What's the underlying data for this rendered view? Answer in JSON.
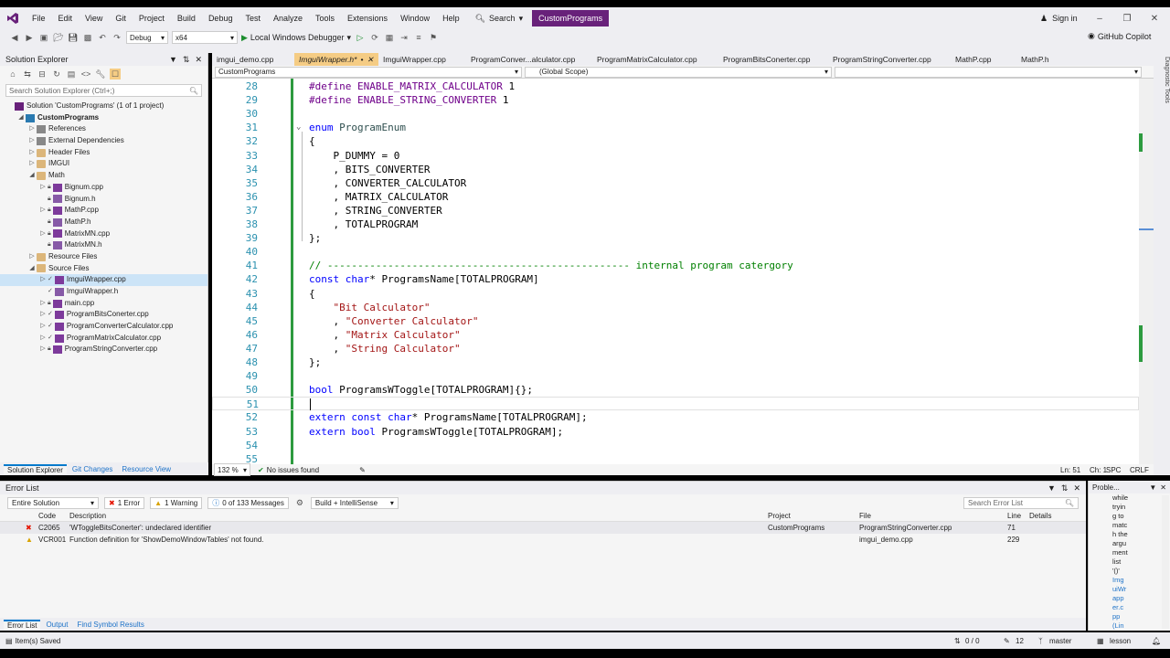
{
  "menu": [
    "File",
    "Edit",
    "View",
    "Git",
    "Project",
    "Build",
    "Debug",
    "Test",
    "Analyze",
    "Tools",
    "Extensions",
    "Window",
    "Help"
  ],
  "search_label": "Search",
  "solution_name": "CustomPrograms",
  "signin_label": "Sign in",
  "toolbar": {
    "config": "Debug",
    "platform": "x64",
    "run_label": "Local Windows Debugger",
    "copilot_label": "GitHub Copilot"
  },
  "solution_explorer": {
    "title": "Solution Explorer",
    "search_placeholder": "Search Solution Explorer (Ctrl+;)",
    "items": [
      {
        "label": "Solution 'CustomPrograms' (1 of 1 project)",
        "indent": 0,
        "icon": "solution"
      },
      {
        "label": "CustomPrograms",
        "indent": 1,
        "icon": "project",
        "bold": true
      },
      {
        "label": "References",
        "indent": 2,
        "icon": "ref"
      },
      {
        "label": "External Dependencies",
        "indent": 2,
        "icon": "ref"
      },
      {
        "label": "Header Files",
        "indent": 2,
        "icon": "folder"
      },
      {
        "label": "IMGUI",
        "indent": 2,
        "icon": "folder"
      },
      {
        "label": "Math",
        "indent": 2,
        "icon": "folder"
      },
      {
        "label": "Bignum.cpp",
        "indent": 3,
        "icon": "cpp"
      },
      {
        "label": "Bignum.h",
        "indent": 3,
        "icon": "h"
      },
      {
        "label": "MathP.cpp",
        "indent": 3,
        "icon": "cpp"
      },
      {
        "label": "MathP.h",
        "indent": 3,
        "icon": "h"
      },
      {
        "label": "MatrixMN.cpp",
        "indent": 3,
        "icon": "cpp"
      },
      {
        "label": "MatrixMN.h",
        "indent": 3,
        "icon": "h"
      },
      {
        "label": "Resource Files",
        "indent": 2,
        "icon": "folder"
      },
      {
        "label": "Source Files",
        "indent": 2,
        "icon": "folder"
      },
      {
        "label": "ImguiWrapper.cpp",
        "indent": 3,
        "icon": "cpp",
        "selected": true
      },
      {
        "label": "ImguiWrapper.h",
        "indent": 3,
        "icon": "h"
      },
      {
        "label": "main.cpp",
        "indent": 3,
        "icon": "cpp"
      },
      {
        "label": "ProgramBitsConerter.cpp",
        "indent": 3,
        "icon": "cpp"
      },
      {
        "label": "ProgramConverterCalculator.cpp",
        "indent": 3,
        "icon": "cpp"
      },
      {
        "label": "ProgramMatrixCalculator.cpp",
        "indent": 3,
        "icon": "cpp"
      },
      {
        "label": "ProgramStringConverter.cpp",
        "indent": 3,
        "icon": "cpp"
      }
    ],
    "tabs": [
      "Solution Explorer",
      "Git Changes",
      "Resource View"
    ]
  },
  "editor": {
    "tabs": [
      "imgui_demo.cpp",
      "ImguiWrapper.h*",
      "ImguiWrapper.cpp",
      "ProgramConver...alculator.cpp",
      "ProgramMatrixCalculator.cpp",
      "ProgramBitsConerter.cpp",
      "ProgramStringConverter.cpp",
      "MathP.cpp",
      "MathP.h"
    ],
    "active_tab": 1,
    "nav_project": "CustomPrograms",
    "nav_scope": "(Global Scope)",
    "zoom": "132 %",
    "issues": "No issues found",
    "line": "Ln: 51",
    "col": "Ch: 1",
    "spc": "SPC",
    "eol": "CRLF",
    "lines": [
      {
        "n": "28",
        "tokens": [
          [
            "mac",
            "#define "
          ],
          [
            "mac",
            "ENABLE_MATRIX_CALCULATOR"
          ],
          [
            "id",
            " 1"
          ]
        ]
      },
      {
        "n": "29",
        "tokens": [
          [
            "mac",
            "#define "
          ],
          [
            "mac",
            "ENABLE_STRING_CONVERTER"
          ],
          [
            "id",
            " 1"
          ]
        ]
      },
      {
        "n": "30",
        "tokens": []
      },
      {
        "n": "31",
        "tokens": [
          [
            "kw",
            "enum "
          ],
          [
            "enm",
            "ProgramEnum"
          ]
        ]
      },
      {
        "n": "32",
        "tokens": [
          [
            "id",
            "{"
          ]
        ]
      },
      {
        "n": "33",
        "tokens": [
          [
            "id",
            "    P_DUMMY = 0"
          ]
        ]
      },
      {
        "n": "34",
        "tokens": [
          [
            "id",
            "    , BITS_CONVERTER"
          ]
        ]
      },
      {
        "n": "35",
        "tokens": [
          [
            "id",
            "    , CONVERTER_CALCULATOR"
          ]
        ]
      },
      {
        "n": "36",
        "tokens": [
          [
            "id",
            "    , MATRIX_CALCULATOR"
          ]
        ]
      },
      {
        "n": "37",
        "tokens": [
          [
            "id",
            "    , STRING_CONVERTER"
          ]
        ]
      },
      {
        "n": "38",
        "tokens": [
          [
            "id",
            "    , TOTALPROGRAM"
          ]
        ]
      },
      {
        "n": "39",
        "tokens": [
          [
            "id",
            "};"
          ]
        ]
      },
      {
        "n": "40",
        "tokens": []
      },
      {
        "n": "41",
        "tokens": [
          [
            "cm",
            "// -------------------------------------------------- internal program catergory"
          ]
        ]
      },
      {
        "n": "42",
        "tokens": [
          [
            "kw",
            "const "
          ],
          [
            "kw",
            "char"
          ],
          [
            "id",
            "* ProgramsName[TOTALPROGRAM]"
          ]
        ]
      },
      {
        "n": "43",
        "tokens": [
          [
            "id",
            "{"
          ]
        ]
      },
      {
        "n": "44",
        "tokens": [
          [
            "id",
            "    "
          ],
          [
            "str",
            "\"Bit Calculator\""
          ]
        ]
      },
      {
        "n": "45",
        "tokens": [
          [
            "id",
            "    , "
          ],
          [
            "str",
            "\"Converter Calculator\""
          ]
        ]
      },
      {
        "n": "46",
        "tokens": [
          [
            "id",
            "    , "
          ],
          [
            "str",
            "\"Matrix Calculator\""
          ]
        ]
      },
      {
        "n": "47",
        "tokens": [
          [
            "id",
            "    , "
          ],
          [
            "str",
            "\"String Calculator\""
          ]
        ]
      },
      {
        "n": "48",
        "tokens": [
          [
            "id",
            "};"
          ]
        ]
      },
      {
        "n": "49",
        "tokens": []
      },
      {
        "n": "50",
        "tokens": [
          [
            "kw",
            "bool "
          ],
          [
            "id",
            "ProgramsWToggle[TOTALPROGRAM]{};"
          ]
        ]
      },
      {
        "n": "51",
        "tokens": []
      },
      {
        "n": "52",
        "tokens": [
          [
            "kw",
            "extern const "
          ],
          [
            "kw",
            "char"
          ],
          [
            "id",
            "* ProgramsName[TOTALPROGRAM];"
          ]
        ]
      },
      {
        "n": "53",
        "tokens": [
          [
            "kw",
            "extern bool "
          ],
          [
            "id",
            "ProgramsWToggle[TOTALPROGRAM];"
          ]
        ]
      },
      {
        "n": "54",
        "tokens": []
      },
      {
        "n": "55",
        "tokens": []
      }
    ]
  },
  "diagnostic_tools": "Diagnostic Tools",
  "error_list": {
    "title": "Error List",
    "scope": "Entire Solution",
    "errors_badge": "1 Error",
    "warnings_badge": "1 Warning",
    "messages_badge": "0 of 133 Messages",
    "build_filter": "Build + IntelliSense",
    "search_placeholder": "Search Error List",
    "columns": [
      "Code",
      "Description",
      "Project",
      "File",
      "Line",
      "Details"
    ],
    "rows": [
      {
        "type": "error",
        "code": "C2065",
        "description": "'WToggleBitsConerter': undeclared identifier",
        "project": "CustomPrograms",
        "file": "ProgramStringConverter.cpp",
        "line": "71"
      },
      {
        "type": "warning",
        "code": "VCR001",
        "description": "Function definition for 'ShowDemoWindowTables' not found.",
        "project": "",
        "file": "imgui_demo.cpp",
        "line": "229"
      }
    ],
    "tabs": [
      "Error List",
      "Output",
      "Find Symbol Results"
    ]
  },
  "problems_panel": {
    "title": "Proble...",
    "text_lines": [
      "while",
      "tryin",
      "g to",
      "matc",
      "h the",
      "argu",
      "ment",
      "list",
      "'()'"
    ],
    "link_lines": [
      "Img",
      "uiWr",
      "app",
      "er.c",
      "pp",
      "(Lin"
    ]
  },
  "status": {
    "left": "Item(s) Saved",
    "updown": "0 / 0",
    "pencil": "12",
    "branch": "master",
    "repo": "lesson"
  }
}
